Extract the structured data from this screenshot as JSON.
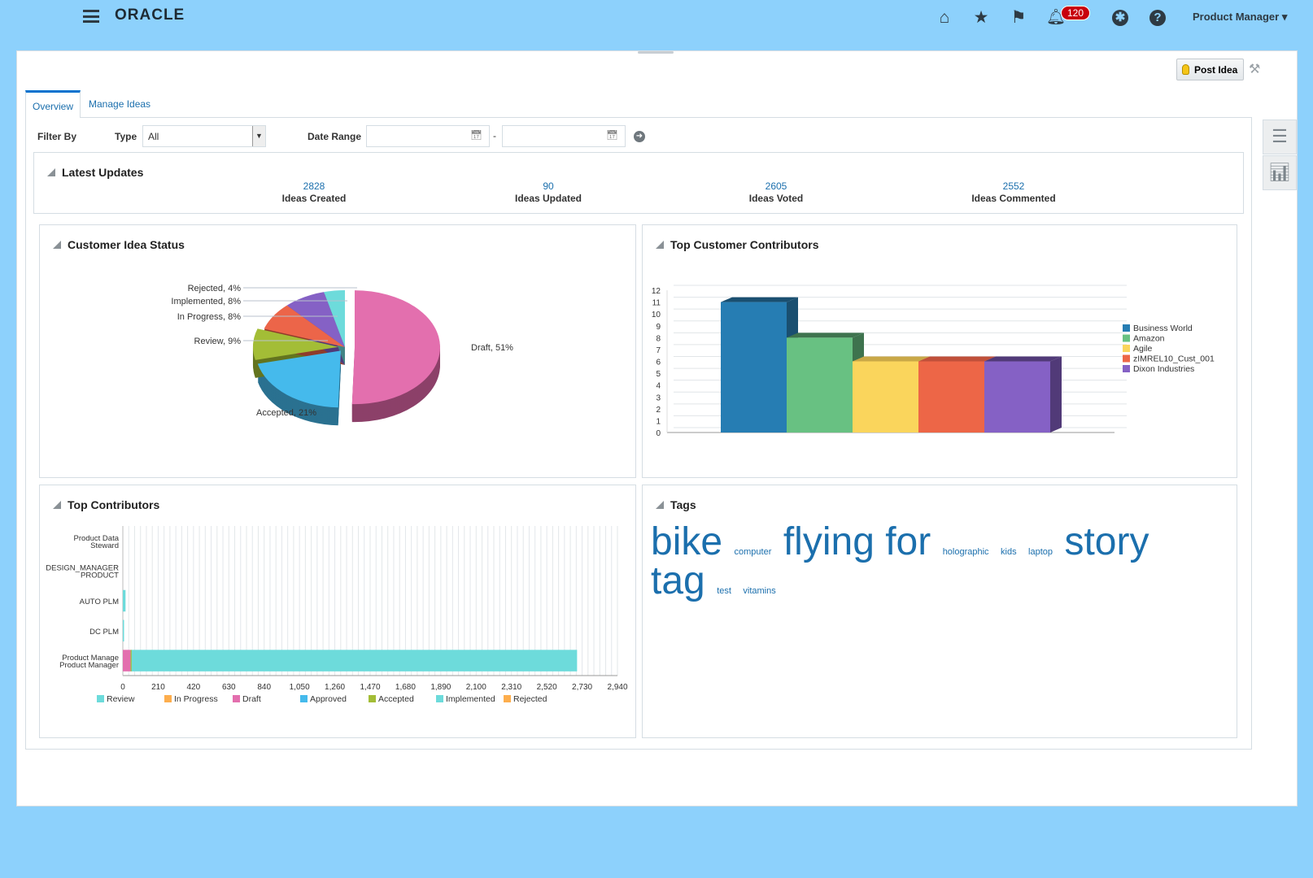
{
  "header": {
    "logo": "ORACLE",
    "notifications_count": "120",
    "user": "Product Manager",
    "icons": [
      "menu-icon",
      "home-icon",
      "star-icon",
      "flag-icon",
      "bell-icon",
      "accessibility-icon",
      "help-icon"
    ]
  },
  "toolbar": {
    "post_idea": "Post Idea"
  },
  "tabs": [
    {
      "label": "Overview",
      "active": true
    },
    {
      "label": "Manage Ideas",
      "active": false
    }
  ],
  "filter": {
    "filter_by": "Filter By",
    "type_label": "Type",
    "type_value": "All",
    "date_range_label": "Date Range",
    "date_from": "",
    "date_to": "",
    "separator": "-"
  },
  "latest_updates": {
    "title": "Latest Updates",
    "stats": [
      {
        "value": "2828",
        "label": "Ideas Created"
      },
      {
        "value": "90",
        "label": "Ideas Updated"
      },
      {
        "value": "2605",
        "label": "Ideas Voted"
      },
      {
        "value": "2552",
        "label": "Ideas Commented"
      }
    ]
  },
  "panels": {
    "status": "Customer Idea Status",
    "customers": "Top Customer Contributors",
    "contributors": "Top Contributors",
    "tags": "Tags"
  },
  "tags": [
    {
      "text": "bike",
      "size": "xl"
    },
    {
      "text": "computer",
      "size": "s"
    },
    {
      "text": "flying for",
      "size": "xl"
    },
    {
      "text": "holographic",
      "size": "s"
    },
    {
      "text": "kids",
      "size": "s"
    },
    {
      "text": "laptop",
      "size": "s"
    },
    {
      "text": "story tag",
      "size": "xl"
    },
    {
      "text": "test",
      "size": "s"
    },
    {
      "text": "vitamins",
      "size": "s"
    }
  ],
  "chart_data": [
    {
      "type": "pie",
      "title": "Customer Idea Status",
      "slices": [
        {
          "label": "Draft",
          "value": 51,
          "text": "Draft, 51%",
          "color": "#e36fae",
          "dark": "#8c4069"
        },
        {
          "label": "Accepted",
          "value": 21,
          "text": "Accepted, 21%",
          "color": "#45baec",
          "dark": "#2a7190"
        },
        {
          "label": "Review",
          "value": 9,
          "text": "Review, 9%",
          "color": "#a3bd36",
          "dark": "#63741f"
        },
        {
          "label": "In Progress",
          "value": 8,
          "text": "In Progress, 8%",
          "color": "#ec6549",
          "dark": "#8f3c2b"
        },
        {
          "label": "Implemented",
          "value": 8,
          "text": "Implemented, 8%",
          "color": "#8561c5",
          "dark": "#513a78"
        },
        {
          "label": "Rejected",
          "value": 4,
          "text": "Rejected, 4%",
          "color": "#6ddbdb",
          "dark": "#428585"
        }
      ]
    },
    {
      "type": "bar",
      "title": "Top Customer Contributors",
      "ylim": [
        0,
        12
      ],
      "yticks": [
        0,
        1,
        2,
        3,
        4,
        5,
        6,
        7,
        8,
        9,
        10,
        11,
        12
      ],
      "legend": "right",
      "series": [
        {
          "name": "Business World",
          "value": 11,
          "color": "#267db3",
          "dark": "#1a4f70"
        },
        {
          "name": "Amazon",
          "value": 8,
          "color": "#68c182",
          "dark": "#3e734e"
        },
        {
          "name": "Agile",
          "value": 6,
          "color": "#fad55c",
          "dark": "#c9a847"
        },
        {
          "name": "zIMREL10_Cust_001",
          "value": 6,
          "color": "#ed6647",
          "dark": "#c0503a"
        },
        {
          "name": "Dixon Industries",
          "value": 6,
          "color": "#8561c5",
          "dark": "#513a78"
        }
      ]
    },
    {
      "type": "bar",
      "orientation": "horizontal",
      "stacked": true,
      "title": "Top Contributors",
      "xlim": [
        0,
        2940
      ],
      "xticks": [
        "0",
        "210",
        "420",
        "630",
        "840",
        "1,050",
        "1,260",
        "1,470",
        "1,680",
        "1,890",
        "2,100",
        "2,310",
        "2,520",
        "2,730",
        "2,940"
      ],
      "categories": [
        "Product Data Steward",
        "DESIGN_MANAGER PRODUCT",
        "AUTO PLM",
        "DC PLM",
        "Product Manager"
      ],
      "series": [
        {
          "name": "Review",
          "color": "#6ddbdb",
          "values": [
            0,
            0,
            0,
            0,
            0
          ]
        },
        {
          "name": "In Progress",
          "color": "#fdae4d",
          "values": [
            0,
            0,
            0,
            0,
            0
          ]
        },
        {
          "name": "Draft",
          "color": "#e36fae",
          "values": [
            0,
            0,
            0,
            0,
            46
          ]
        },
        {
          "name": "Approved",
          "color": "#45baec",
          "values": [
            0,
            0,
            0,
            0,
            0
          ]
        },
        {
          "name": "Accepted",
          "color": "#a3bd36",
          "values": [
            0,
            0,
            0,
            0,
            6
          ]
        },
        {
          "name": "Implemented",
          "color": "#6ddbdb",
          "values": [
            0,
            0,
            16,
            5,
            2648
          ]
        },
        {
          "name": "Rejected",
          "color": "#fdae4d",
          "values": [
            0,
            0,
            0,
            0,
            0
          ]
        }
      ]
    }
  ]
}
